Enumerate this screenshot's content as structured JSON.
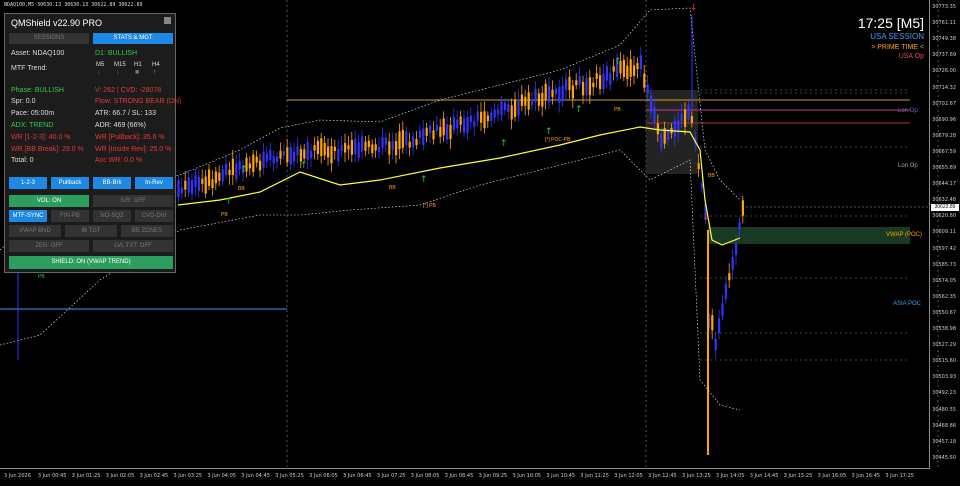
{
  "symbol_info": "NDAQ100,M5  30630.13 30630.13 30622.89 30622.89",
  "y_axis_ticks": [
    "30773.35",
    "30761.11",
    "30749.38",
    "30737.69",
    "30726.00",
    "30714.32",
    "30702.67",
    "30690.96",
    "30679.28",
    "30667.59",
    "30655.89",
    "30644.17",
    "30632.48",
    "30620.80",
    "30609.11",
    "30597.42",
    "30585.73",
    "30574.05",
    "30562.35",
    "30550.67",
    "30538.98",
    "30527.29",
    "30515.60",
    "30503.93",
    "30492.23",
    "30480.55",
    "30468.86",
    "30457.18",
    "30445.50"
  ],
  "current_price_tag": "30622.89",
  "x_axis_ticks": [
    "3 Jun 2026",
    "3 Jun 00:45",
    "3 Jun 01:25",
    "3 Jun 02:05",
    "3 Jun 02:45",
    "3 Jun 03:25",
    "3 Jun 04:05",
    "3 Jun 04:45",
    "3 Jun 05:25",
    "3 Jun 06:05",
    "3 Jun 06:45",
    "3 Jun 07:25",
    "3 Jun 08:05",
    "3 Jun 08:45",
    "3 Jun 09:25",
    "3 Jun 10:05",
    "3 Jun 10:45",
    "3 Jun 11:25",
    "3 Jun 12:05",
    "3 Jun 12:45",
    "3 Jun 13:25",
    "3 Jun 14:05",
    "3 Jun 14:45",
    "3 Jun 15:25",
    "3 Jun 16:05",
    "3 Jun 16:45",
    "3 Jun 17:25"
  ],
  "right_info": {
    "clock": "17:25 [M5]",
    "session": "USA SESSION",
    "prime": "> PRIME TIME <",
    "usa_op": "USA Op"
  },
  "levels": {
    "lon_op_1": "Lon Op",
    "lon_op_2": "Lon Op",
    "vwap_poc": "VWAP (POC)",
    "asia_poc": "ASIA POC"
  },
  "chart_markers": {
    "pb": "PB",
    "poc_pb": "[*] POC-PB",
    "star_pb": "[*] PB",
    "bb": "BB"
  },
  "panel": {
    "title": "QMShield v22.90 PRO",
    "tabs": [
      "SESSIONS",
      "STATS & MGT"
    ],
    "asset": "Asset: NDAQ100",
    "d1": "D1: BULLISH",
    "mtf_label": "MTF Trend:",
    "timeframes": [
      "M5",
      "M15",
      "H1",
      "H4"
    ],
    "phase": "Phase: BULLISH",
    "vol_cvd": "V: 262 | CVD: -28078",
    "spr": "Spr: 0.0",
    "flow": "Flow: STRONG BEAR (DN)",
    "pace": "Pace: 05:00m",
    "atr": "ATR: 66.7 / SL: 133",
    "adx": "ADX: TREND",
    "adr": "ADR: 469 (66%)",
    "wr_123": "WR [1-2-3]: 40.0 %",
    "wr_pullback": "WR [Pullback]: 35.6 %",
    "wr_bb": "WR [BB Break]: 29.0 %",
    "wr_inside": "WR [Inside Rev]: 25.0 %",
    "total": "Total: 0",
    "acc_wr": "Acc WR: 0.0 %",
    "mode_buttons": [
      "1-2-3",
      "Pullback",
      "BB-Brk",
      "In-Rev"
    ],
    "vol": "VOL: ON",
    "sr": "S/R: OFF",
    "mtf_sync": "MTF-SYNC",
    "fin_pb": "FIN-PB",
    "no_sqz": "NO-SQZ",
    "cvd_div": "CVD-DIV",
    "vwap_bnd": "VWAP BND",
    "ib_tgt": "IB TGT",
    "bb_zones": "BB ZONES",
    "zen": "ZEN: OFF",
    "lvl_txt": "LVL TXT: OFF",
    "shield": "SHIELD: ON (VWAP TREND)"
  },
  "colors": {
    "bull_candle": "#3333ff",
    "bear_candle": "#ffa500",
    "vwap": "#ffff33",
    "bands": "#ffffff",
    "accent_blue": "#1e88e5",
    "green_btn": "#2e9e5e"
  }
}
